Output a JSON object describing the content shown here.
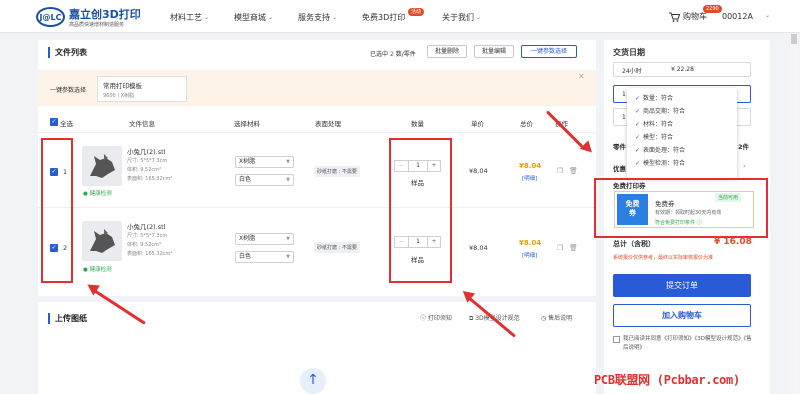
{
  "header": {
    "logo_mark": "J@LC",
    "logo_title": "嘉立创3D打印",
    "logo_sub": "高品质快速增材制造服务",
    "nav": [
      {
        "label": "材料工艺",
        "caret": "⌄"
      },
      {
        "label": "模型商城",
        "caret": "⌄"
      },
      {
        "label": "服务支持",
        "caret": "⌄"
      },
      {
        "label": "免费3D打印",
        "badge": "活动"
      },
      {
        "label": "关于我们",
        "caret": "⌄"
      }
    ],
    "cart_label": "购物车",
    "cart_count": "2290",
    "user": "00012A"
  },
  "file_list": {
    "title": "文件列表",
    "selected_prefix": "已选中",
    "selected_count": "2",
    "selected_suffix": "数/零件",
    "batch_delete": "批量删除",
    "batch_edit": "批量编辑",
    "one_click": "一键参数选择",
    "param_label": "一键参数选择",
    "param_template": "常用打印模板",
    "param_template_sub": "9600丨X树脂",
    "columns": [
      "全选",
      "文件信息",
      "选择材料",
      "表面处理",
      "数量",
      "单价",
      "总价",
      "操作"
    ],
    "rows": [
      {
        "index": "1",
        "name": "小兔几(2).stl",
        "size": "尺寸: 5*5*7.3cm",
        "volume": "体积: 9.52cm³",
        "area": "表面积: 165.32cm²",
        "check": "健康检测",
        "material": "X树脂",
        "color": "白色",
        "surface": "砂纸打磨 : 不需要",
        "qty": "1",
        "qty_note": "样品",
        "unit": "¥8.04",
        "total": "¥8.04",
        "detail": "[明细]"
      },
      {
        "index": "2",
        "name": "小兔几(2).stl",
        "size": "尺寸: 5*5*7.3cm",
        "volume": "体积: 9.52cm³",
        "area": "表面积: 165.32cm²",
        "check": "健康检测",
        "material": "X树脂",
        "color": "白色",
        "surface": "砂纸打磨 : 不需要",
        "qty": "1",
        "qty_note": "样品",
        "unit": "¥8.04",
        "total": "¥8.04",
        "detail": "[明细]"
      }
    ]
  },
  "upload": {
    "title": "上传图纸",
    "links": [
      "打印须知",
      "3D模型设计规范",
      "售后说明"
    ],
    "upload_icon": "upload-arrow-icon"
  },
  "sidebar": {
    "title": "交货日期",
    "delivery_option": "24小时",
    "delivery_price": "¥ 22.28",
    "field1_prefix": "1",
    "field2_prefix": "1",
    "row_label": "零件",
    "row_value": "2件",
    "discount_label": "优惠",
    "popup_items": [
      "数量：符合",
      "商品交期：符合",
      "材料：符合",
      "模型：符合",
      "表面处理：符合",
      "模型检测：符合"
    ],
    "coupon_section_label": "免费打印券",
    "coupon_badge": "当前可用",
    "coupon_logo_top": "免费",
    "coupon_logo_bottom": "券",
    "coupon_title": "免费券",
    "coupon_valid": "有效期：领取时起30天内有效",
    "coupon_rule": "符合免费打印条件",
    "total_label": "总计（含税）",
    "total_value": "¥ 16.08",
    "total_note": "系统报价仅供参考，最终以实际审核报价为准",
    "submit": "提交订单",
    "add_cart": "加入购物车",
    "agree_text": "我已阅读并同意《打印须知》《3D模型设计规范》《售后说明》"
  },
  "watermark": "PCB联盟网 (Pcbbar.com)",
  "colors": {
    "accent": "#2a5bd7",
    "annotation": "#e23030",
    "price": "#e8a000",
    "total": "#e24b2a"
  }
}
